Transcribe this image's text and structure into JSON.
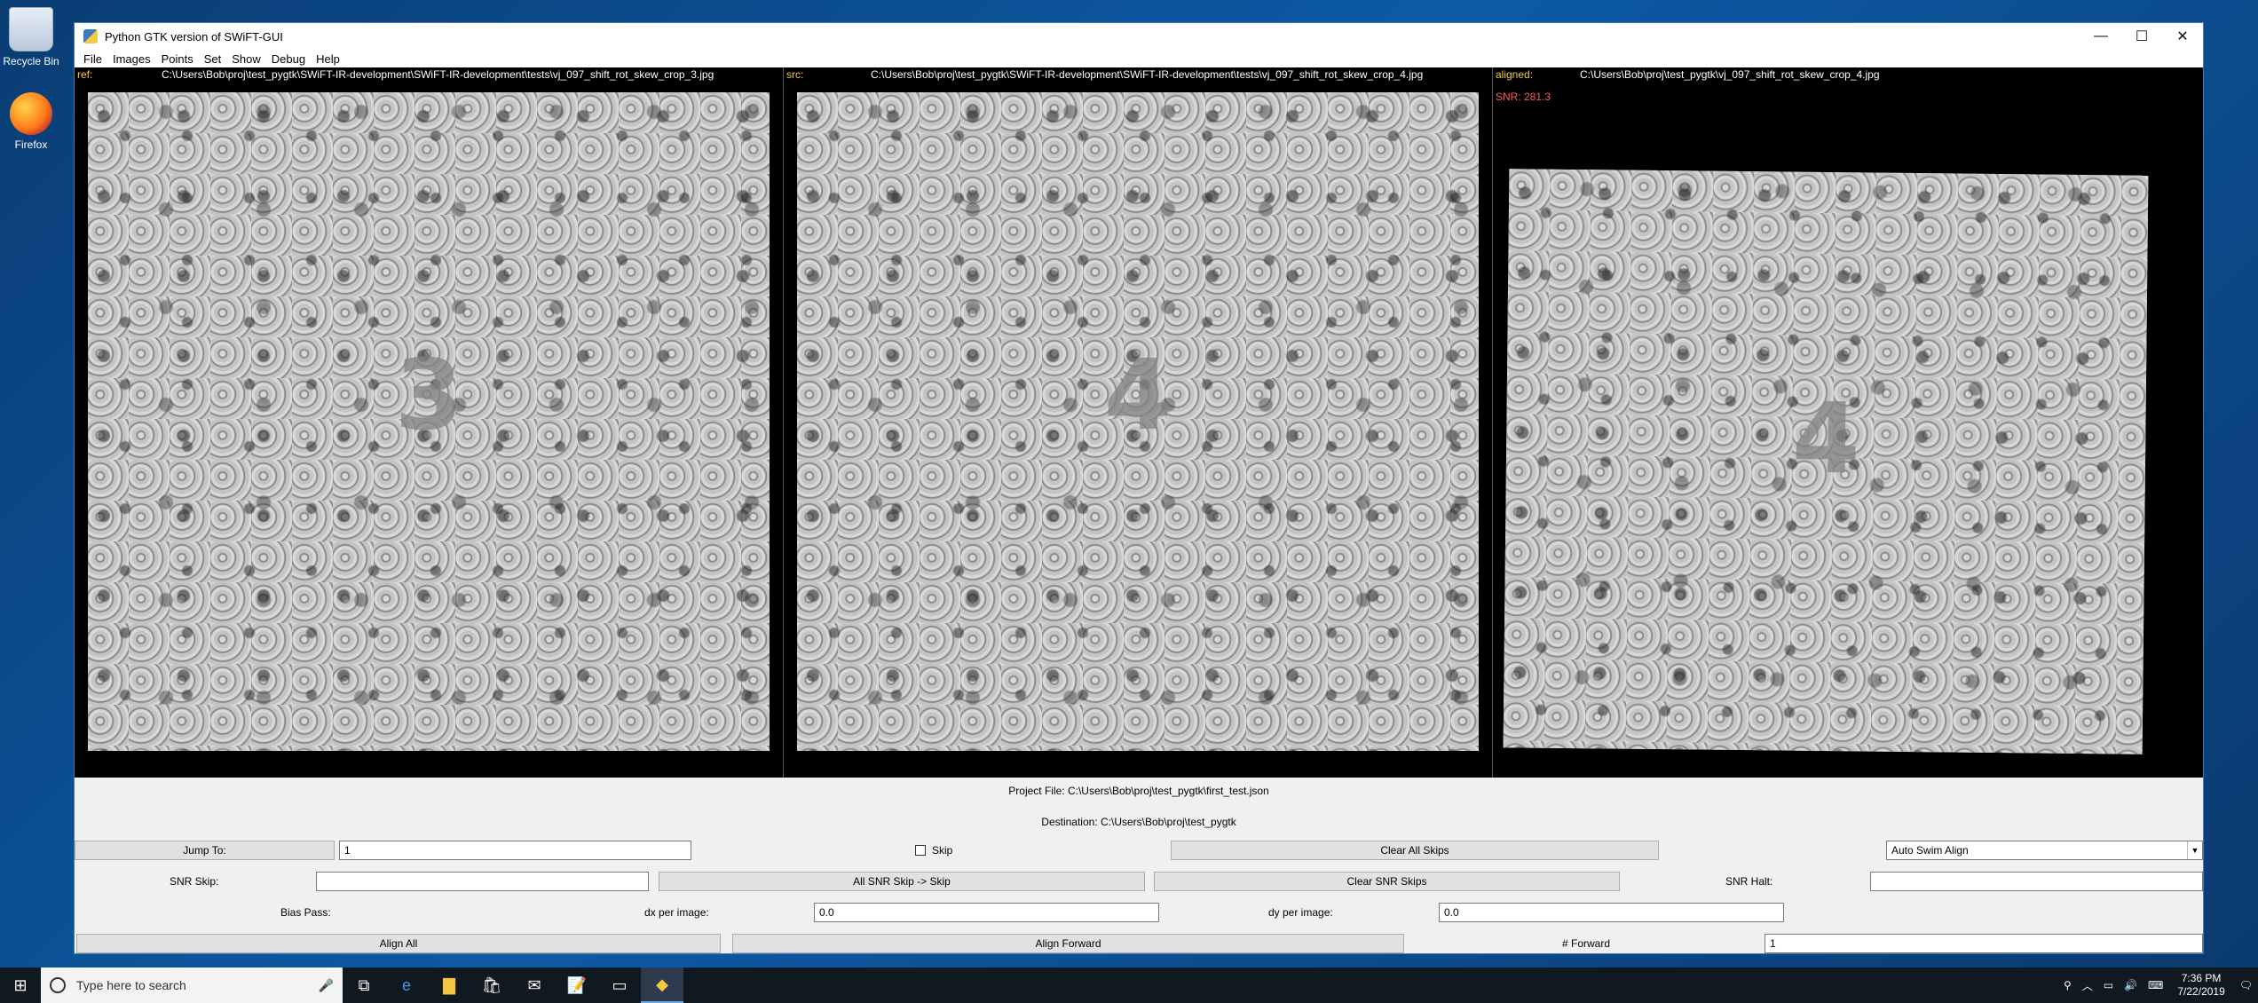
{
  "desktop": {
    "icons": [
      {
        "label": "Recycle Bin"
      },
      {
        "label": "Firefox"
      }
    ]
  },
  "window": {
    "title": "Python GTK version of SWiFT-GUI",
    "controls": {
      "minimize": "—",
      "maximize": "☐",
      "close": "✕"
    }
  },
  "menu": [
    "File",
    "Images",
    "Points",
    "Set",
    "Show",
    "Debug",
    "Help"
  ],
  "panes": {
    "ref": {
      "label": "ref:",
      "path": "C:\\Users\\Bob\\proj\\test_pygtk\\SWiFT-IR-development\\SWiFT-IR-development\\tests\\vj_097_shift_rot_skew_crop_3.jpg",
      "section": "3"
    },
    "src": {
      "label": "src:",
      "path": "C:\\Users\\Bob\\proj\\test_pygtk\\SWiFT-IR-development\\SWiFT-IR-development\\tests\\vj_097_shift_rot_skew_crop_4.jpg",
      "section": "4"
    },
    "aligned": {
      "label": "aligned:",
      "path": "C:\\Users\\Bob\\proj\\test_pygtk\\vj_097_shift_rot_skew_crop_4.jpg",
      "snr": "SNR: 281.3",
      "section": "4"
    }
  },
  "controls": {
    "project_file": "Project File: C:\\Users\\Bob\\proj\\test_pygtk\\first_test.json",
    "destination": "Destination: C:\\Users\\Bob\\proj\\test_pygtk",
    "jump_to_label": "Jump To:",
    "jump_to_value": "1",
    "skip_label": "Skip",
    "clear_all_skips": "Clear All Skips",
    "align_mode": "Auto Swim Align",
    "snr_skip_label": "SNR Skip:",
    "snr_skip_value": "",
    "all_snr_skip": "All SNR Skip -> Skip",
    "clear_snr_skips": "Clear SNR Skips",
    "snr_halt_label": "SNR Halt:",
    "snr_halt_value": "",
    "bias_pass_label": "Bias Pass:",
    "dx_label": "dx per image:",
    "dx_value": "0.0",
    "dy_label": "dy per image:",
    "dy_value": "0.0",
    "align_all": "Align All",
    "align_forward": "Align Forward",
    "forward_label": "# Forward",
    "forward_value": "1"
  },
  "taskbar": {
    "search_placeholder": "Type here to search",
    "time": "7:36 PM",
    "date": "7/22/2019"
  }
}
